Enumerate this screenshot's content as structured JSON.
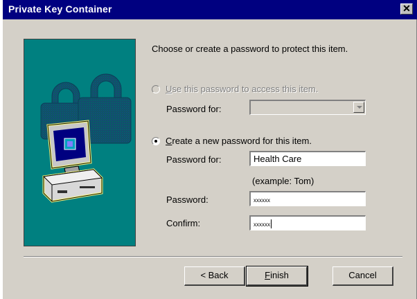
{
  "window": {
    "title": "Private Key Container",
    "close_symbol": "✕"
  },
  "heading": "Choose or create a password to protect this item.",
  "use_existing": {
    "label_accel": "U",
    "label_rest": "se this password to access this item.",
    "password_for_label": "Password for:",
    "password_for_value": "",
    "selected": false,
    "enabled": false
  },
  "create_new": {
    "label_accel": "C",
    "label_rest": "reate a new password for this item.",
    "selected": true,
    "password_for_label": "Password for:",
    "password_for_value": "Health Care",
    "example_hint": "(example: Tom)",
    "password_label": "Password:",
    "password_mask": "xxxxxx",
    "confirm_label": "Confirm:",
    "confirm_mask": "xxxxxx"
  },
  "buttons": {
    "back": "< Back",
    "finish_accel": "F",
    "finish_rest": "inish",
    "cancel": "Cancel"
  },
  "colors": {
    "titlebar": "#000080",
    "dialog_face": "#d4d0c8",
    "art_background": "#008080"
  },
  "icons": {
    "art": "padlock-computer-illustration",
    "close": "close-icon"
  }
}
